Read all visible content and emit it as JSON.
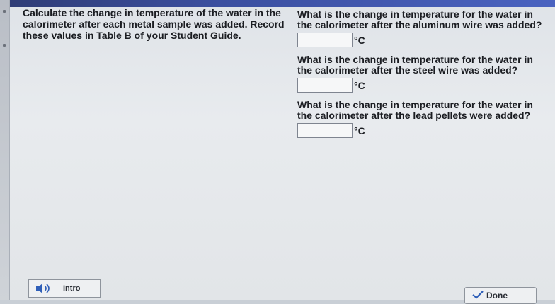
{
  "instructions": {
    "text": "Calculate the change in temperature of the water in the calorimeter after each metal sample was added. Record these values in Table B of your Student Guide."
  },
  "questions": [
    {
      "text": "What is the change in temperature for the water in the calorimeter after the aluminum wire was added?",
      "value": "",
      "unit": "°C"
    },
    {
      "text": "What is the change in temperature for the water in the calorimeter after the steel wire was added?",
      "value": "",
      "unit": "°C"
    },
    {
      "text": "What is the change in temperature for the water in the calorimeter after the lead pellets were added?",
      "value": "",
      "unit": "°C"
    }
  ],
  "buttons": {
    "intro_label": "Intro",
    "done_label": "Done"
  },
  "colors": {
    "accent": "#3b4fa0"
  }
}
